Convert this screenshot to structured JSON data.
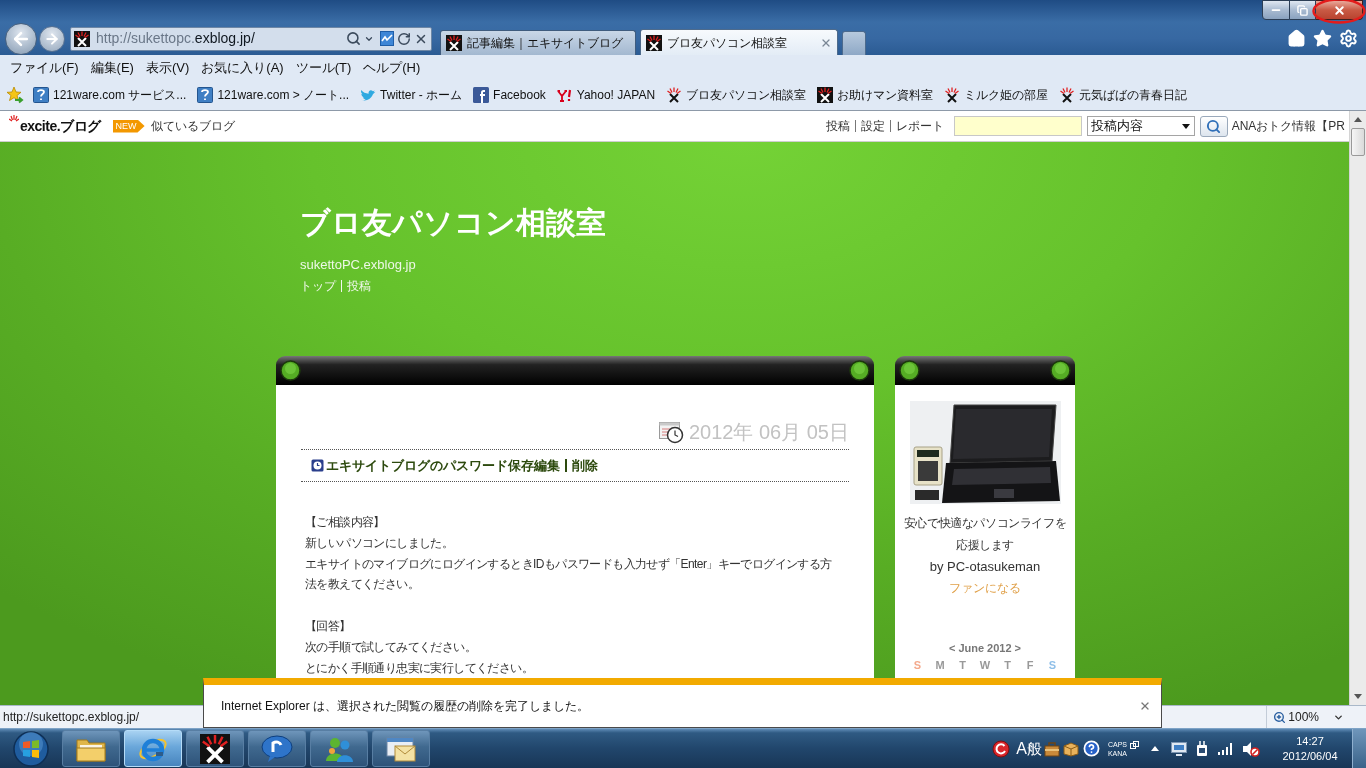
{
  "browser": {
    "address": {
      "prefix": "http://sukettopc.",
      "domain": "exblog.jp/"
    },
    "tabs": [
      {
        "label": "記事編集｜エキサイトブログ",
        "selected": false
      },
      {
        "label": "ブロ友パソコン相談室",
        "selected": true
      }
    ]
  },
  "menu": [
    "ファイル(F)",
    "編集(E)",
    "表示(V)",
    "お気に入り(A)",
    "ツール(T)",
    "ヘルプ(H)"
  ],
  "favorites": [
    {
      "label": "121ware.com サービス...",
      "kind": "info"
    },
    {
      "label": "121ware.com > ノート...",
      "kind": "info"
    },
    {
      "label": "Twitter - ホーム",
      "kind": "bird"
    },
    {
      "label": "Facebook",
      "kind": "facebook"
    },
    {
      "label": "Yahoo! JAPAN",
      "kind": "yahoo"
    },
    {
      "label": "ブロ友パソコン相談室",
      "kind": "spark"
    },
    {
      "label": "お助けマン資料室",
      "kind": "spark-dark"
    },
    {
      "label": "ミルク姫の部屋",
      "kind": "spark"
    },
    {
      "label": "元気ばばの青春日記",
      "kind": "spark"
    }
  ],
  "site_header": {
    "logo": "excite.ブログ",
    "badge": "NEW",
    "similar_link": "似ているブログ",
    "links": [
      "投稿",
      "設定",
      "レポート"
    ],
    "scope": "投稿内容",
    "ad": "ANAおトク情報【PR"
  },
  "blog": {
    "title": "ブロ友パソコン相談室",
    "url": "sukettoPC.exblog.jp",
    "nav": [
      "トップ",
      "投稿"
    ]
  },
  "post": {
    "date": "2012年 06月 05日",
    "title": "エキサイトブログのパスワード保存",
    "actions": [
      "編集",
      "削除"
    ],
    "paragraphs": [
      [
        [
          "【ご相談内容】"
        ],
        [
          "新しいパソコンにしました。"
        ],
        [
          "エキサイトのマイブログにログインするときIDもパスワードも入力せず「Enter」キーでログインする方",
          "法を教えてください。"
        ]
      ],
      [
        [
          "【回答】"
        ],
        [
          "次の手順で試してみてください。"
        ],
        [
          "とにかく手順通り忠実に実行してください。"
        ]
      ]
    ]
  },
  "sidebar": {
    "tagline": [
      "安心で快適なパソコンライフを",
      "応援します"
    ],
    "author": "by PC-otasukeman",
    "fan_link": "ファンになる",
    "calendar": {
      "prev": "<",
      "month": "June 2012",
      "next": ">",
      "weekdays": [
        {
          "label": "S",
          "color": "#f4a98c"
        },
        {
          "label": "M",
          "color": "#999999"
        },
        {
          "label": "T",
          "color": "#999999"
        },
        {
          "label": "W",
          "color": "#999999"
        },
        {
          "label": "T",
          "color": "#999999"
        },
        {
          "label": "F",
          "color": "#999999"
        },
        {
          "label": "S",
          "color": "#8fbfe8"
        }
      ]
    }
  },
  "status_bar": {
    "url": "http://sukettopc.exblog.jp/",
    "zoom": "100%"
  },
  "notification": {
    "message": "Internet Explorer は、選択された閲覧の履歴の削除を完了しました。"
  },
  "taskbar": {
    "apps": [
      {
        "kind": "folder",
        "selected": false
      },
      {
        "kind": "browser",
        "selected": true
      },
      {
        "kind": "spark",
        "selected": false
      },
      {
        "kind": "chat",
        "selected": false
      },
      {
        "kind": "people",
        "selected": false
      },
      {
        "kind": "mail",
        "selected": false
      }
    ],
    "ime": [
      "A",
      "般"
    ],
    "locks": [
      "CAPS",
      "KANA"
    ],
    "time": "14:27",
    "date": "2012/06/04"
  }
}
